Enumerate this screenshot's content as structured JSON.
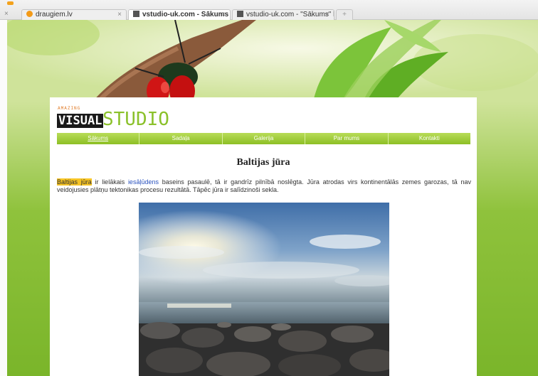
{
  "browser": {
    "tabs": [
      {
        "title": "draugiem.lv"
      },
      {
        "title": "vstudio-uk.com - Sākums"
      },
      {
        "title": "vstudio-uk.com - \"Sākums\" labošana"
      }
    ],
    "new_tab_label": "+",
    "close_label": "×"
  },
  "site": {
    "logo_small": "AMAZING",
    "logo_visual": "VISUAL",
    "logo_studio": "STUDIO"
  },
  "nav": [
    {
      "label": "Sākums"
    },
    {
      "label": "Sadaļa"
    },
    {
      "label": "Galerija"
    },
    {
      "label": "Par mums"
    },
    {
      "label": "Kontakti"
    }
  ],
  "article": {
    "title": "Baltijas jūra",
    "highlight": "Baltijas jūra",
    "part1": " ir lielākais ",
    "link": "iesāļūdens",
    "part2": " baseins pasaulē, tā ir gandrīz pilnībā noslēgta. Jūra atrodas virs kontinentālās zemes garozas, tā nav veidojusies plātņu tektonikas procesu rezultātā. Tāpēc jūra ir salīdzinoši sekla."
  },
  "colors": {
    "accent_green": "#8bc12b",
    "highlight_yellow": "#f6c425",
    "link_blue": "#2a52be"
  }
}
